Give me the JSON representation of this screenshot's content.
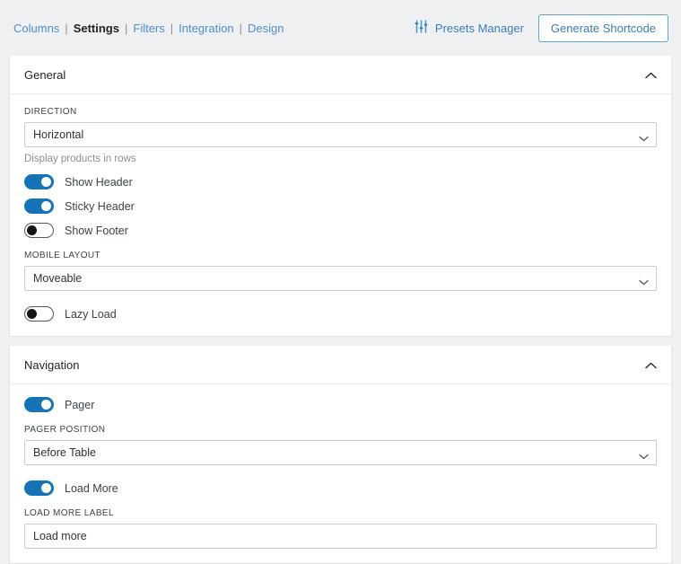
{
  "topbar": {
    "tabs": [
      {
        "label": "Columns",
        "active": false
      },
      {
        "label": "Settings",
        "active": true
      },
      {
        "label": "Filters",
        "active": false
      },
      {
        "label": "Integration",
        "active": false
      },
      {
        "label": "Design",
        "active": false
      }
    ],
    "separator": "|",
    "presets_manager_label": "Presets Manager",
    "presets_manager_icon": "sliders-icon",
    "generate_shortcode_label": "Generate Shortcode"
  },
  "colors": {
    "accent_blue": "#1574b8",
    "link_blue": "#4f8ccc",
    "page_bg": "#eff0f1",
    "panel_bg": "#ffffff"
  },
  "sections": {
    "general": {
      "title": "General",
      "collapse_icon": "chevron-up-icon",
      "direction": {
        "label": "DIRECTION",
        "value": "Horizontal",
        "help": "Display products in rows"
      },
      "toggles": [
        {
          "label": "Show Header",
          "state": "on"
        },
        {
          "label": "Sticky Header",
          "state": "on"
        },
        {
          "label": "Show Footer",
          "state": "off"
        }
      ],
      "mobile_layout": {
        "label": "MOBILE LAYOUT",
        "value": "Moveable"
      },
      "lazy_load": {
        "label": "Lazy Load",
        "state": "off"
      }
    },
    "navigation": {
      "title": "Navigation",
      "collapse_icon": "chevron-up-icon",
      "pager": {
        "label": "Pager",
        "state": "on"
      },
      "pager_position": {
        "label": "PAGER POSITION",
        "value": "Before Table"
      },
      "load_more": {
        "label": "Load More",
        "state": "on"
      },
      "load_more_label": {
        "label": "LOAD MORE LABEL",
        "value": "Load more",
        "placeholder": "Load more"
      }
    }
  }
}
